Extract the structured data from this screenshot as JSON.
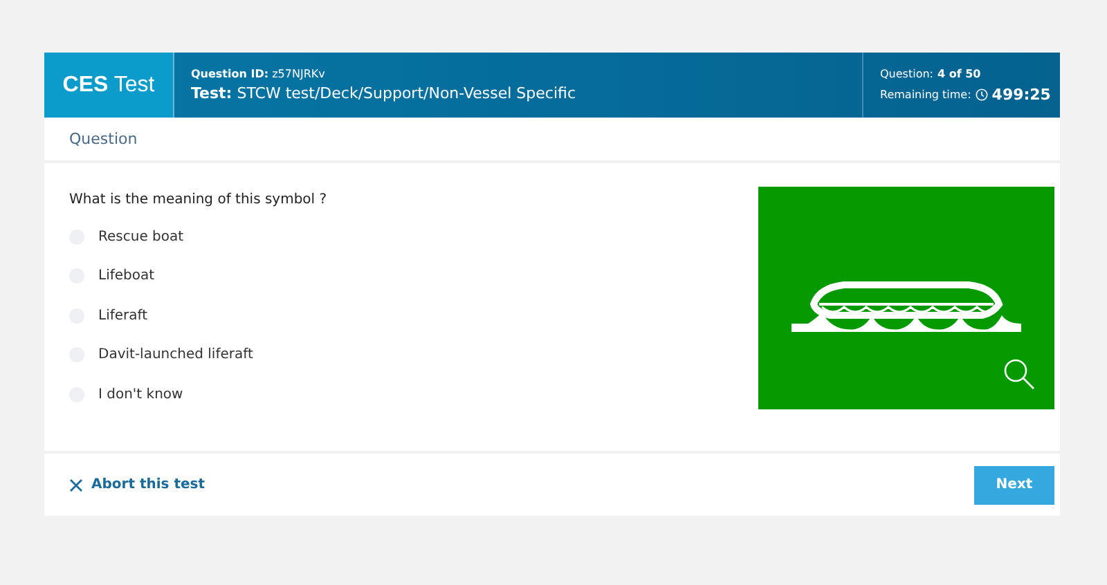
{
  "header": {
    "logo": "**CES** Test",
    "question_id": "**Question ID:** z57NJRKv",
    "test": "**Test:** STCW test/Deck/Support/Non-Vessel Specific",
    "progress_label": "Question:",
    "progress_value": "4 of 50",
    "remaining_label": "Remaining time:",
    "remaining_value": "499:25"
  },
  "section_tab": "Question",
  "question": "What is the meaning of this symbol ?",
  "options": [
    {
      "label": "Rescue boat",
      "selected": false
    },
    {
      "label": "Lifeboat",
      "selected": false
    },
    {
      "label": "Liferaft",
      "selected": false
    },
    {
      "label": "Davit-launched liferaft",
      "selected": false
    },
    {
      "label": "I don't know",
      "selected": false
    }
  ],
  "footer": {
    "abort": "Abort this test",
    "next": "Next"
  }
}
